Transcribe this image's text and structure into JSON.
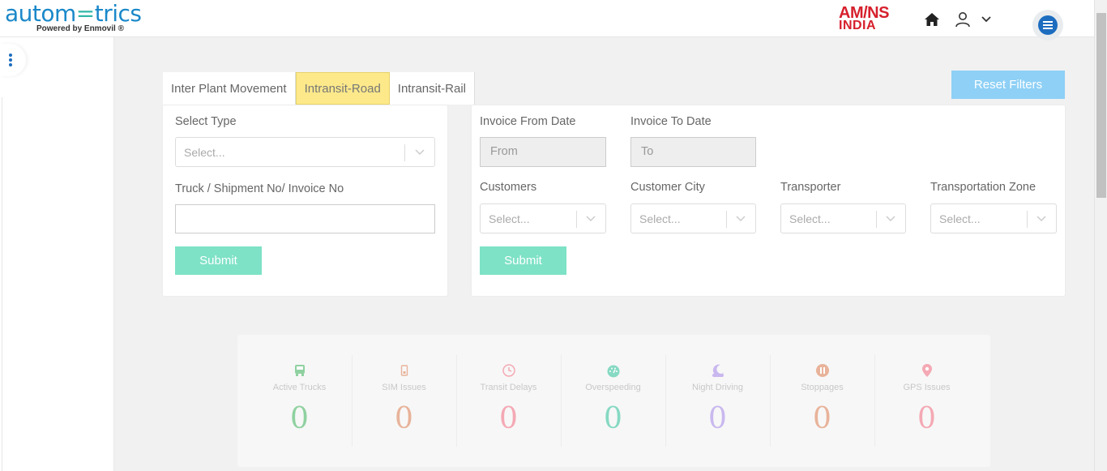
{
  "header": {
    "logo_text_before": "autom",
    "logo_text_accent": "=",
    "logo_text_after": "trics",
    "logo_tagline": "Powered by Enmovil ®",
    "brand_line1": "AM/NS",
    "brand_line2": "INDIA",
    "icons": [
      "home-icon",
      "user-icon",
      "chevron-down-icon",
      "hamburger-menu-icon"
    ]
  },
  "tabs": [
    {
      "label": "Inter Plant Movement",
      "active": false
    },
    {
      "label": "Intransit-Road",
      "active": true
    },
    {
      "label": "Intransit-Rail",
      "active": false
    }
  ],
  "reset_filters_label": "Reset Filters",
  "left_filter": {
    "select_type_label": "Select Type",
    "select_type_placeholder": "Select...",
    "search_label": "Truck / Shipment No/ Invoice No",
    "search_value": "",
    "submit_label": "Submit"
  },
  "right_filter": {
    "invoice_from_label": "Invoice From Date",
    "invoice_from_placeholder": "From",
    "invoice_to_label": "Invoice To Date",
    "invoice_to_placeholder": "To",
    "customers_label": "Customers",
    "customer_city_label": "Customer City",
    "transporter_label": "Transporter",
    "transport_zone_label": "Transportation Zone",
    "select_placeholder": "Select...",
    "submit_label": "Submit"
  },
  "stats": [
    {
      "name": "Active Trucks",
      "value": "0",
      "color": "#8fd1a0",
      "icon": "truck-icon"
    },
    {
      "name": "SIM Issues",
      "value": "0",
      "color": "#e8b39a",
      "icon": "sim-card-icon"
    },
    {
      "name": "Transit Delays",
      "value": "0",
      "color": "#f4a9b4",
      "icon": "clock-icon"
    },
    {
      "name": "Overspeeding",
      "value": "0",
      "color": "#86d9c3",
      "icon": "speedometer-icon"
    },
    {
      "name": "Night Driving",
      "value": "0",
      "color": "#c9b8ef",
      "icon": "moon-icon"
    },
    {
      "name": "Stoppages",
      "value": "0",
      "color": "#e8b39a",
      "icon": "pause-icon"
    },
    {
      "name": "GPS Issues",
      "value": "0",
      "color": "#f4a9b4",
      "icon": "map-pin-icon"
    }
  ]
}
